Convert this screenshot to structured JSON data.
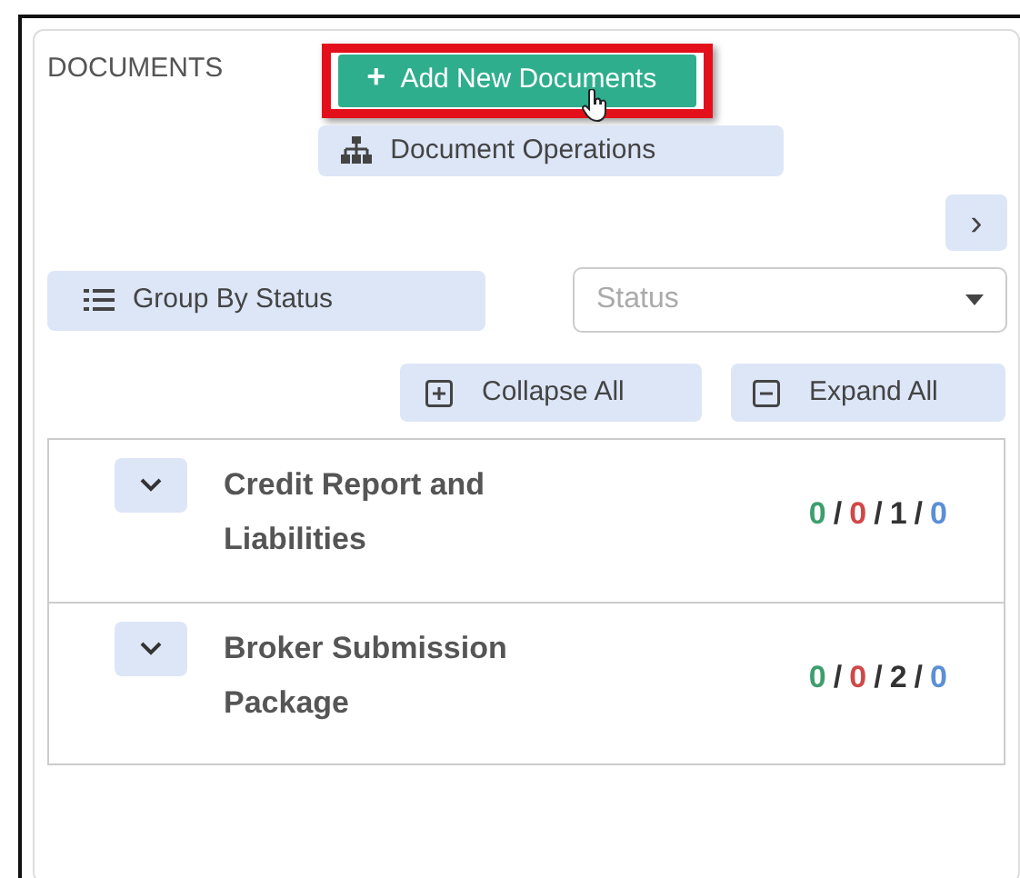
{
  "panel": {
    "title": "DOCUMENTS"
  },
  "add_button": {
    "label": "Add New Documents",
    "icon": "+",
    "highlighted": true
  },
  "operations_button": {
    "label": "Document Operations"
  },
  "next_button": {
    "icon": "›"
  },
  "group_button": {
    "label": "Group By Status"
  },
  "status_select": {
    "placeholder": "Status"
  },
  "collapse_button": {
    "label": "Collapse All"
  },
  "expand_button": {
    "label": "Expand All"
  },
  "groups": [
    {
      "title": "Credit Report and Liabilities",
      "expanded": false,
      "separator": "/",
      "counts": [
        {
          "value": "0",
          "color": "#3f9e6e"
        },
        {
          "value": "0",
          "color": "#d04848"
        },
        {
          "value": "1",
          "color": "#333333"
        },
        {
          "value": "0",
          "color": "#5b8fd6"
        }
      ]
    },
    {
      "title": "Broker Submission Package",
      "expanded": false,
      "separator": "/",
      "counts": [
        {
          "value": "0",
          "color": "#3f9e6e"
        },
        {
          "value": "0",
          "color": "#d04848"
        },
        {
          "value": "2",
          "color": "#333333"
        },
        {
          "value": "0",
          "color": "#5b8fd6"
        }
      ]
    }
  ]
}
